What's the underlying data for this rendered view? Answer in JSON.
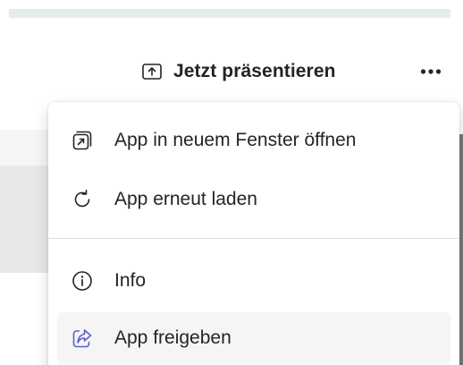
{
  "toolbar": {
    "present_label": "Jetzt präsentieren",
    "present_icon": "share-screen-icon",
    "more_icon": "more-horizontal-icon"
  },
  "menu": {
    "items": [
      {
        "label": "App in neuem Fenster öffnen",
        "icon": "open-in-new-window-icon"
      },
      {
        "label": "App erneut laden",
        "icon": "reload-icon"
      },
      {
        "label": "Info",
        "icon": "info-icon"
      },
      {
        "label": "App freigeben",
        "icon": "share-icon",
        "icon_color": "#5b5fc7",
        "highlighted": true
      }
    ]
  },
  "colors": {
    "text": "#242424",
    "accent": "#5b5fc7",
    "hover_bg": "#f5f5f5",
    "top_strip": "#e4eded"
  }
}
